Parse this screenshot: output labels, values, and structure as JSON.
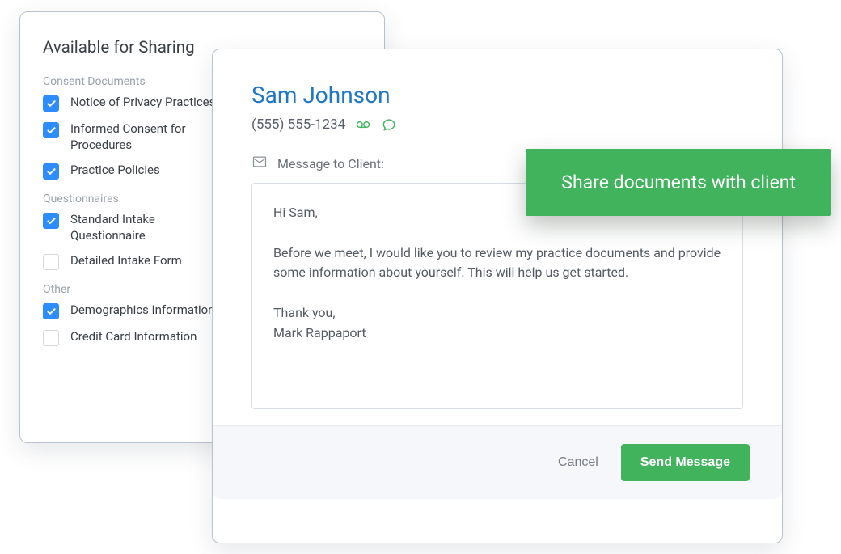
{
  "sharing": {
    "title": "Available for Sharing",
    "groups": {
      "consent": {
        "label": "Consent Documents",
        "items": [
          {
            "label": "Notice of Privacy Practices",
            "checked": true
          },
          {
            "label": "Informed Consent for Procedures",
            "checked": true
          },
          {
            "label": "Practice Policies",
            "checked": true
          }
        ]
      },
      "questionnaires": {
        "label": "Questionnaires",
        "items": [
          {
            "label": "Standard Intake Questionnaire",
            "checked": true
          },
          {
            "label": "Detailed Intake Form",
            "checked": false
          }
        ]
      },
      "other": {
        "label": "Other",
        "items": [
          {
            "label": "Demographics Information",
            "checked": true
          },
          {
            "label": "Credit Card Information",
            "checked": false
          }
        ]
      }
    }
  },
  "message_panel": {
    "client_name": "Sam Johnson",
    "phone": "(555) 555-1234",
    "message_label": "Message to Client:",
    "message_body": "Hi Sam,\n\nBefore we meet, I would like you to review my practice documents and provide some information about yourself. This will help us get started.\n\nThank you,\nMark Rappaport"
  },
  "banner": {
    "text": "Share documents with client"
  },
  "actions": {
    "cancel": "Cancel",
    "send": "Send Message"
  },
  "colors": {
    "accent_blue": "#2d8cff",
    "brand_green": "#41b35d",
    "link_blue": "#1f77c5"
  }
}
